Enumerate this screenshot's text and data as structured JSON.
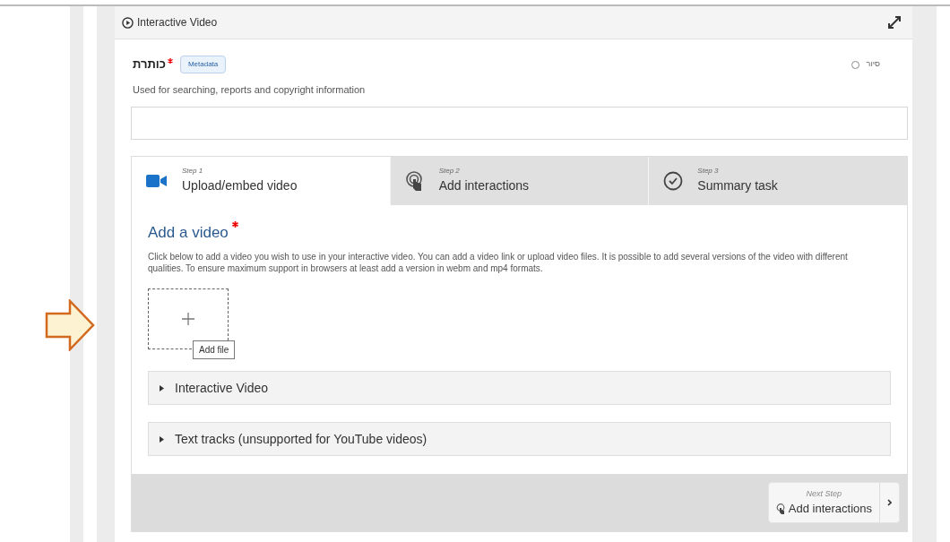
{
  "header": {
    "title": "Interactive Video"
  },
  "title_field": {
    "label": "כותרת",
    "required": true,
    "tag": "Metadata",
    "help": "סיור",
    "description": "Used for searching, reports and copyright information"
  },
  "steps": [
    {
      "step": "Step 1",
      "label": "Upload/embed video",
      "kind": "video",
      "selected": true
    },
    {
      "step": "Step 2",
      "label": "Add interactions",
      "kind": "touch",
      "selected": false
    },
    {
      "step": "Step 3",
      "label": "Summary task",
      "kind": "check",
      "selected": false
    }
  ],
  "video_section": {
    "title": "Add a video",
    "required": true,
    "description": "Click below to add a video you wish to use in your interactive video. You can add a video link or upload video files. It is possible to add several versions of the video with different qualities. To ensure maximum support in browsers at least add a version in webm and mp4 formats.",
    "add_file_tooltip": "Add file"
  },
  "accordions": [
    {
      "label": "Interactive Video",
      "expanded": false
    },
    {
      "label": "Text tracks (unsupported for YouTube videos)",
      "expanded": false
    }
  ],
  "next_step": {
    "caption": "Next Step",
    "label": "Add interactions"
  }
}
